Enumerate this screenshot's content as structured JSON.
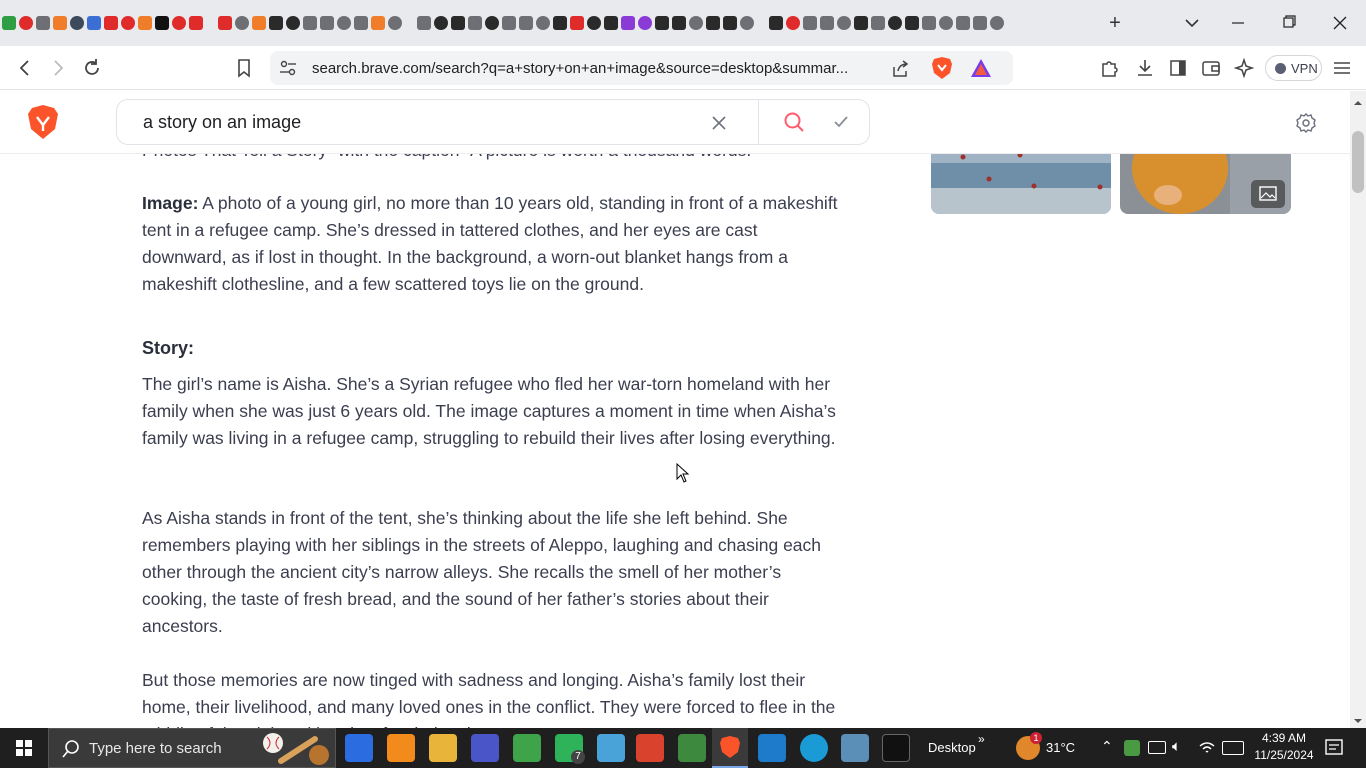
{
  "browser": {
    "url": "search.brave.com/search?q=a+story+on+an+image&source=desktop&summar...",
    "vpn_label": "VPN",
    "new_tab_glyph": "+",
    "tab_favicons": [
      "green",
      "red",
      "grey",
      "orange",
      "slate",
      "blue",
      "red",
      "red",
      "orange",
      "black",
      "red",
      "red",
      "red",
      "grey",
      "orange",
      "dark",
      "dark",
      "grey",
      "grey",
      "grey",
      "grey",
      "orange",
      "grey",
      "grey",
      "dark",
      "dark",
      "grey",
      "dark",
      "grey",
      "grey",
      "grey",
      "dark",
      "red",
      "dark",
      "dark",
      "purple",
      "purple",
      "dark",
      "dark",
      "grey",
      "dark",
      "dark",
      "grey",
      "dark",
      "red",
      "grey",
      "grey",
      "grey",
      "dark",
      "grey",
      "dark",
      "dark",
      "grey",
      "grey",
      "grey",
      "grey",
      "grey",
      "grey",
      "orange",
      "grey",
      "grey"
    ]
  },
  "search": {
    "query": "a story on an image"
  },
  "article": {
    "cut_line": "Photos That Tell a Story” with the caption “A picture is worth a thousand words.”",
    "image_label": "Image:",
    "image_text": " A photo of a young girl, no more than 10 years old, standing in front of a makeshift tent in a refugee camp. She’s dressed in tattered clothes, and her eyes are cast downward, as if lost in thought. In the background, a worn-out blanket hangs from a makeshift clothesline, and a few scattered toys lie on the ground.",
    "story_heading": "Story:",
    "para1": "The girl’s name is Aisha. She’s a Syrian refugee who fled her war-torn homeland with her family when she was just 6 years old. The image captures a moment in time when Aisha’s family was living in a refugee camp, struggling to rebuild their lives after losing everything.",
    "para2": "As Aisha stands in front of the tent, she’s thinking about the life she left behind. She remembers playing with her siblings in the streets of Aleppo, laughing and chasing each other through the ancient city’s narrow alleys. She recalls the smell of her mother’s cooking, the taste of fresh bread, and the sound of her father’s stories about their ancestors.",
    "para3": "But those memories are now tinged with sadness and longing. Aisha’s family lost their home, their livelihood, and many loved ones in the conflict. They were forced to flee in the middle of the night, with only a few belongings."
  },
  "taskbar": {
    "search_placeholder": "Type here to search",
    "desktop_label": "Desktop",
    "weather": "31°C",
    "time": "4:39 AM",
    "date": "11/25/2024",
    "whatsapp_badge": "7",
    "weather_badge": "1"
  },
  "colors": {
    "brave_orange": "#fb542b",
    "search_icon": "#ff5b6b",
    "tabstrip_bg": "#e8eaed",
    "taskbar_bg": "#1f1f1f"
  }
}
